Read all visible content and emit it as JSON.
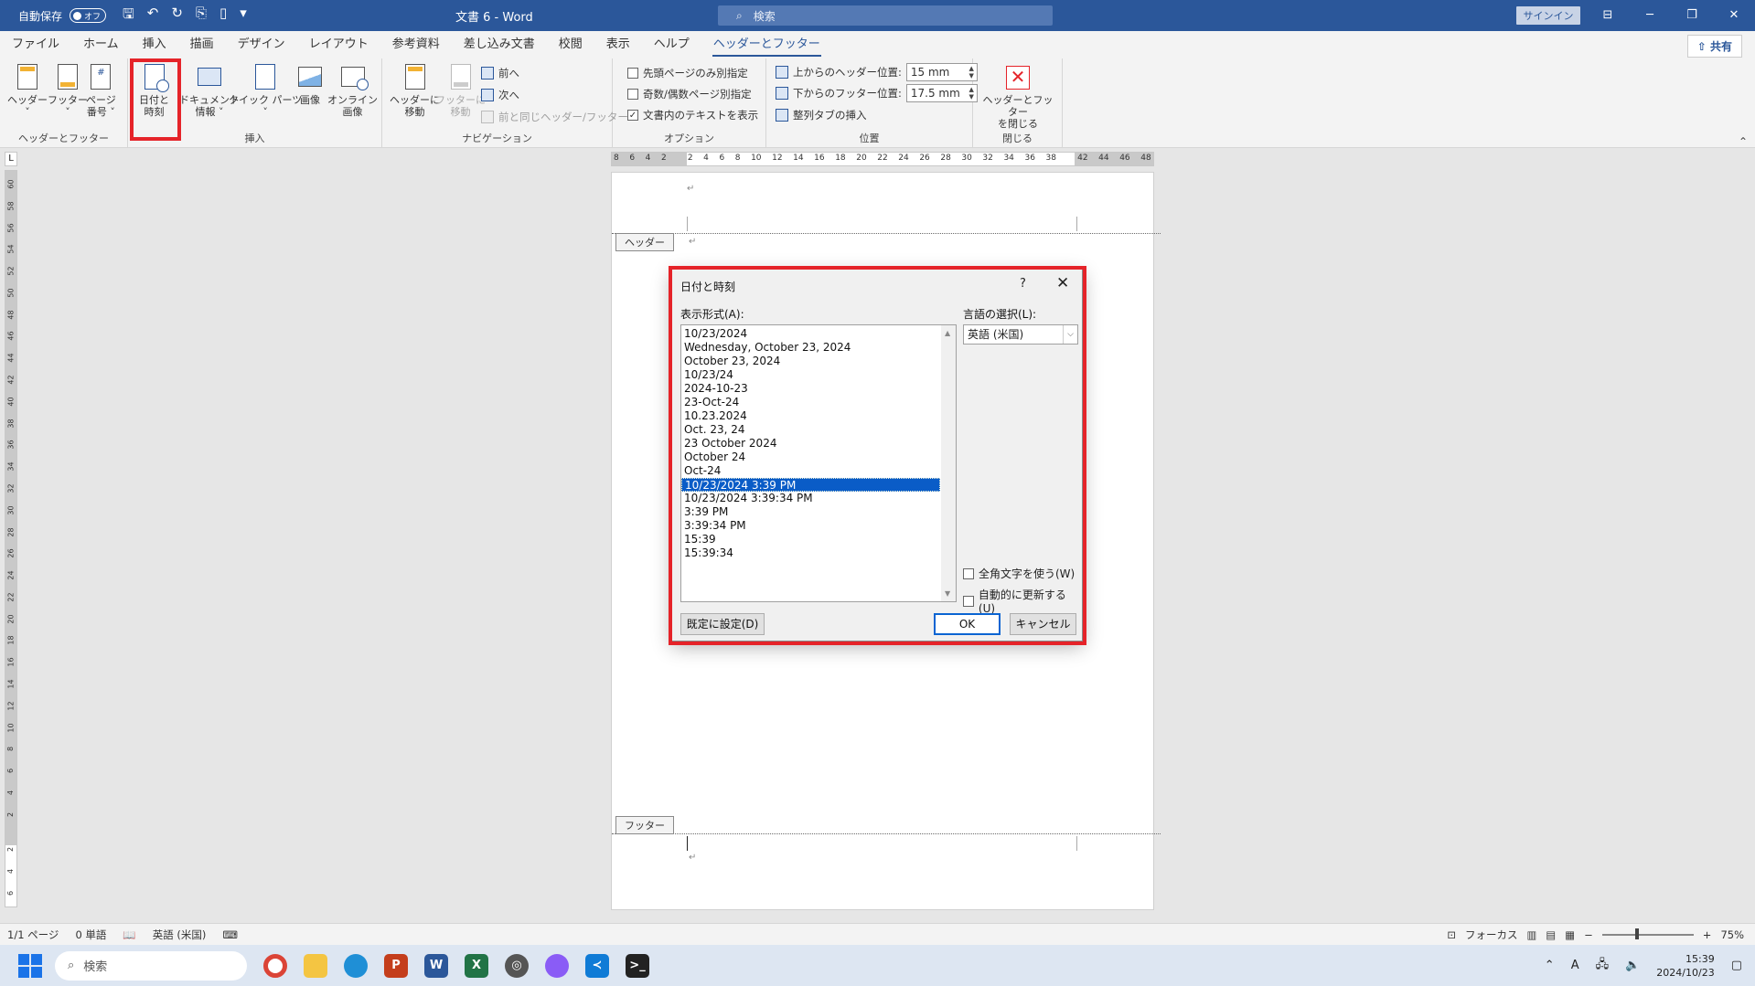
{
  "titlebar": {
    "autosave_label": "自動保存",
    "autosave_state": "オフ",
    "doc_title": "文書 6  -  Word",
    "search_placeholder": "検索",
    "signin": "サインイン"
  },
  "tabs": [
    "ファイル",
    "ホーム",
    "挿入",
    "描画",
    "デザイン",
    "レイアウト",
    "参考資料",
    "差し込み文書",
    "校閲",
    "表示",
    "ヘルプ",
    "ヘッダーとフッター"
  ],
  "share_label": "共有",
  "ribbon": {
    "groups": {
      "header_footer": "ヘッダーとフッター",
      "insert": "挿入",
      "navigation": "ナビゲーション",
      "options": "オプション",
      "position": "位置",
      "close": "閉じる"
    },
    "header_btn": "ヘッダー",
    "footer_btn": "フッター",
    "page_number_btn_1": "ページ",
    "page_number_btn_2": "番号",
    "date_time_btn_1": "日付と",
    "date_time_btn_2": "時刻",
    "doc_info_btn_1": "ドキュメント",
    "doc_info_btn_2": "情報",
    "quick_parts_btn": "クイック パーツ",
    "image_btn": "画像",
    "online_image_btn_1": "オンライン",
    "online_image_btn_2": "画像",
    "goto_header_1": "ヘッダーに",
    "goto_header_2": "移動",
    "goto_footer_1": "フッターに",
    "goto_footer_2": "移動",
    "prev": "前へ",
    "next": "次へ",
    "link_prev": "前と同じヘッダー/フッター",
    "opt_first_page": "先頭ページのみ別指定",
    "opt_odd_even": "奇数/偶数ページ別指定",
    "opt_show_text": "文書内のテキストを表示",
    "header_pos_label": "上からのヘッダー位置:",
    "header_pos_value": "15 mm",
    "footer_pos_label": "下からのフッター位置:",
    "footer_pos_value": "17.5 mm",
    "align_tab": "整列タブの挿入",
    "close_btn_1": "ヘッダーとフッター",
    "close_btn_2": "を閉じる"
  },
  "ruler": {
    "h_ticks": [
      "8",
      "6",
      "4",
      "2",
      "",
      "2",
      "4",
      "6",
      "8",
      "10",
      "12",
      "14",
      "16",
      "18",
      "20",
      "22",
      "24",
      "26",
      "28",
      "30",
      "32",
      "34",
      "36",
      "38",
      "",
      "42",
      "44",
      "46",
      "48"
    ],
    "v_ticks": [
      "60",
      "58",
      "56",
      "54",
      "52",
      "50",
      "48",
      "46",
      "44",
      "42",
      "40",
      "38",
      "36",
      "34",
      "32",
      "30",
      "28",
      "26",
      "24",
      "22",
      "20",
      "18",
      "16",
      "14",
      "12",
      "10",
      "8",
      "6",
      "4",
      "2",
      "",
      "2",
      "4",
      "6"
    ],
    "corner": "L"
  },
  "page": {
    "header_tag": "ヘッダー",
    "footer_tag": "フッター",
    "para_mark": "↵"
  },
  "dialog": {
    "title": "日付と時刻",
    "help": "?",
    "close": "✕",
    "formats_label": "表示形式(A):",
    "language_label": "言語の選択(L):",
    "formats": [
      "10/23/2024",
      "Wednesday, October 23, 2024",
      "October 23, 2024",
      "10/23/24",
      "2024-10-23",
      "23-Oct-24",
      "10.23.2024",
      "Oct. 23, 24",
      "23 October 2024",
      "October 24",
      "Oct-24",
      "10/23/2024 3:39 PM",
      "10/23/2024 3:39:34 PM",
      "3:39 PM",
      "3:39:34 PM",
      "15:39",
      "15:39:34"
    ],
    "selected_index": 11,
    "language_value": "英語 (米国)",
    "fullwidth_label": "全角文字を使う(W)",
    "autoupdate_label": "自動的に更新する(U)",
    "default_btn": "既定に設定(D)",
    "ok_btn": "OK",
    "cancel_btn": "キャンセル"
  },
  "statusbar": {
    "page": "1/1 ページ",
    "words": "0 単語",
    "language": "英語 (米国)",
    "focus": "フォーカス",
    "zoom": "75%"
  },
  "taskbar": {
    "search_placeholder": "検索",
    "time": "15:39",
    "date": "2024/10/23"
  },
  "colors": {
    "word_blue": "#2b579a",
    "highlight_red": "#e52329",
    "selection_blue": "#0a5cc7"
  }
}
